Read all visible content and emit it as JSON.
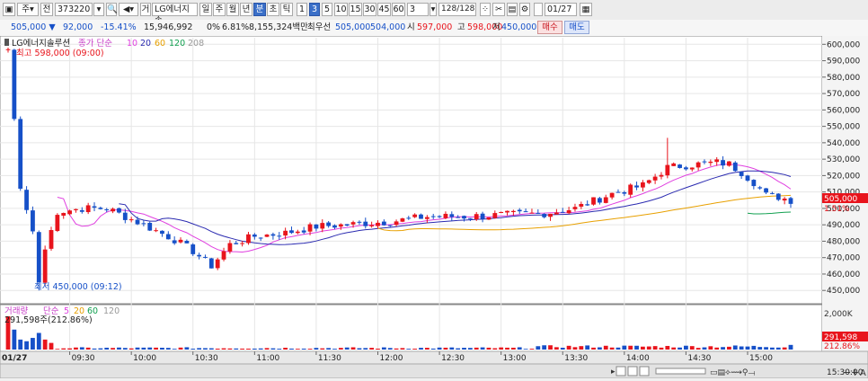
{
  "toolbar": {
    "market": "주",
    "period_select": "전",
    "code": "373220",
    "stock_name": "LG에너지솔",
    "prefix_mark": "거",
    "periods": [
      "일",
      "주",
      "월",
      "년",
      "분",
      "초",
      "틱"
    ],
    "selected_period": "분",
    "minutes": [
      "1",
      "3",
      "5",
      "10",
      "15",
      "30",
      "45",
      "60"
    ],
    "selected_minute": "3",
    "custom_value": "3",
    "count": "128",
    "count_total": "/128",
    "date": "01/27"
  },
  "infobar": {
    "price": "505,000",
    "arrow": "▼",
    "change": "92,000",
    "change_pct": "-15.41%",
    "volume": "15,946,992",
    "zero_pct": "0%",
    "turnover_pct": "6.81%",
    "amount": "8,155,324백만",
    "best_label": "최우선",
    "best_ask": "505,000",
    "best_bid": "504,000",
    "open_label": "시",
    "open": "597,000",
    "high_label": "고",
    "high": "598,000",
    "low_label": "저",
    "low": "450,000",
    "buy_btn": "매수",
    "sell_btn": "매도"
  },
  "colors": {
    "up": "#e8141c",
    "down": "#1650c8",
    "ma5": "#e040e0",
    "ma20": "#2a2ab0",
    "ma60": "#e8a000",
    "ma120": "#12a050"
  },
  "chart_data": {
    "type": "candlestick",
    "title": "LG에너지솔루션",
    "legend": [
      "종가 단순",
      "10",
      "20",
      "60",
      "120",
      "208"
    ],
    "interval": "3분",
    "x_ticks": [
      "01/27",
      "09:30",
      "10:00",
      "10:30",
      "11:00",
      "11:30",
      "12:00",
      "12:30",
      "13:00",
      "13:30",
      "14:00",
      "14:30",
      "15:00",
      "15:30:00"
    ],
    "y_ticks": [
      "600,000",
      "590,000",
      "580,000",
      "570,000",
      "560,000",
      "550,000",
      "540,000",
      "530,000",
      "520,000",
      "510,000",
      "500,000",
      "490,000",
      "480,000",
      "470,000",
      "460,000",
      "450,000"
    ],
    "ylim": [
      443000,
      604000
    ],
    "high_note": "최고 598,000 (09:00)",
    "low_note": "최저 450,000 (09:12)",
    "last_price_label": "505,000",
    "last_pct_label": "1.51%",
    "close_anchors": [
      [
        0,
        597000
      ],
      [
        2,
        512000
      ],
      [
        4,
        486000
      ],
      [
        5,
        455000
      ],
      [
        6,
        475000
      ],
      [
        8,
        498000
      ],
      [
        12,
        500000
      ],
      [
        16,
        500000
      ],
      [
        22,
        490000
      ],
      [
        27,
        481000
      ],
      [
        30,
        474000
      ],
      [
        33,
        465000
      ],
      [
        36,
        478000
      ],
      [
        40,
        483000
      ],
      [
        45,
        485000
      ],
      [
        50,
        489000
      ],
      [
        55,
        490000
      ],
      [
        58,
        491000
      ],
      [
        62,
        492000
      ],
      [
        68,
        495000
      ],
      [
        74,
        495000
      ],
      [
        80,
        496000
      ],
      [
        87,
        497000
      ],
      [
        92,
        500000
      ],
      [
        98,
        509000
      ],
      [
        103,
        514000
      ],
      [
        107,
        525000
      ],
      [
        112,
        527000
      ],
      [
        115,
        528000
      ],
      [
        117,
        527000
      ],
      [
        119,
        522000
      ],
      [
        121,
        516000
      ],
      [
        123,
        508000
      ],
      [
        125,
        507000
      ],
      [
        127,
        505000
      ]
    ],
    "volume_panel": {
      "label": "거래량",
      "legend": [
        "단순",
        "5",
        "20",
        "60",
        "120"
      ],
      "summary": "291,598주(212.86%)",
      "y_tick": "2,000K",
      "last_volume": "291,598",
      "last_pct": "212.86%"
    }
  },
  "bottom": {
    "time_label": "15:30:00"
  }
}
